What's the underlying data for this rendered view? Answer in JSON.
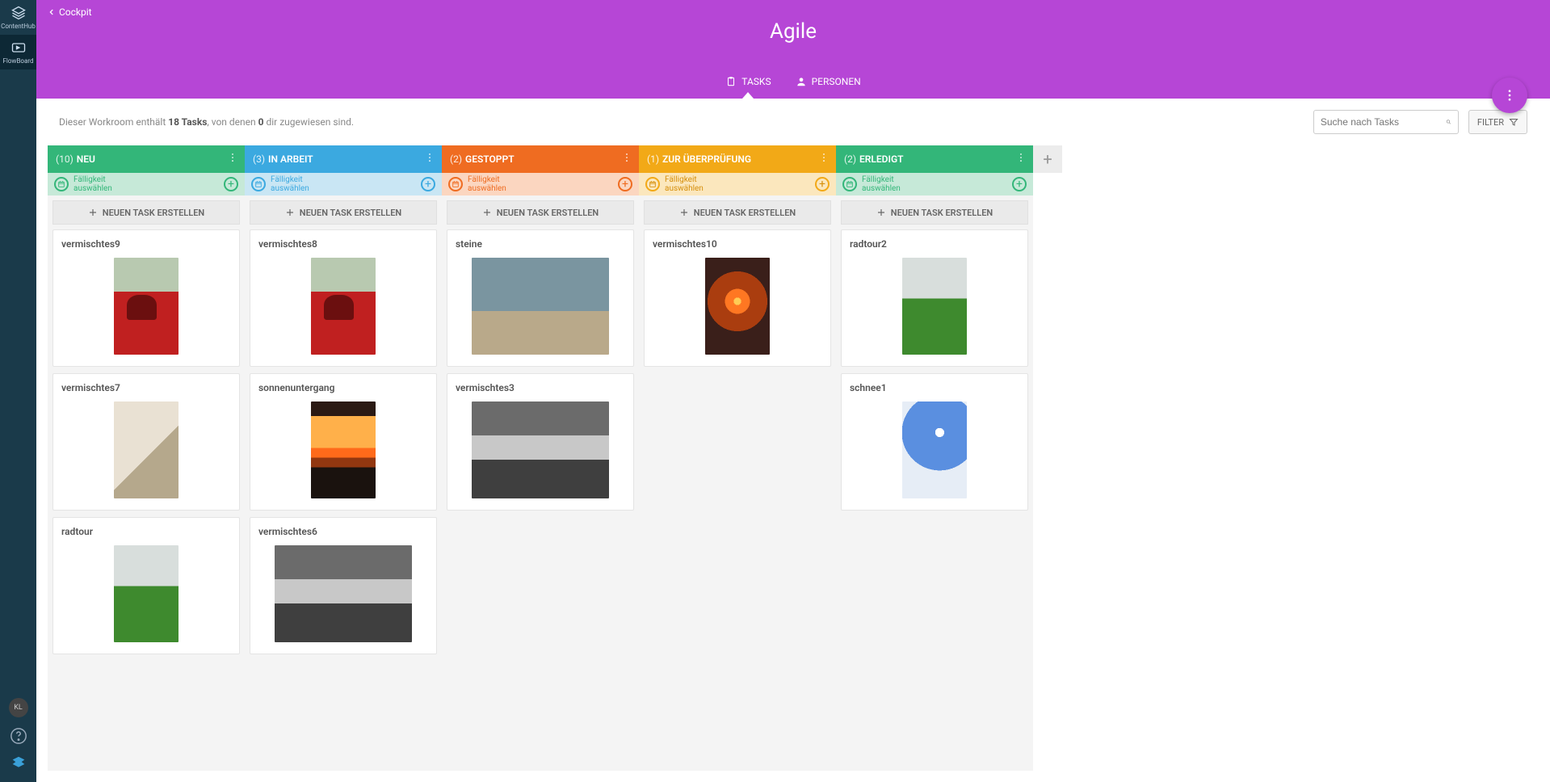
{
  "rail": {
    "items": [
      {
        "label": "ContentHub"
      },
      {
        "label": "FlowBoard"
      }
    ],
    "avatar": "KL"
  },
  "breadcrumb": "Cockpit",
  "title": "Agile",
  "tabs": {
    "tasks": "TASKS",
    "people": "PERSONEN"
  },
  "summary": {
    "pre": "Dieser Workroom enthält ",
    "count": "18 Tasks",
    "mid": ", von denen ",
    "assigned": "0",
    "post": " dir zugewiesen sind."
  },
  "search_placeholder": "Suche nach Tasks",
  "filter_label": "FILTER",
  "due_label": "Fälligkeit\nauswählen",
  "new_task_label": "NEUEN TASK ERSTELLEN",
  "columns": [
    {
      "count": "(10)",
      "name": "NEU",
      "variant": "c-green",
      "cards": [
        {
          "title": "vermischtes9",
          "thumb": "t-redcar",
          "wide": false
        },
        {
          "title": "vermischtes7",
          "thumb": "t-wedding",
          "wide": false
        },
        {
          "title": "radtour",
          "thumb": "t-grass",
          "wide": false
        }
      ]
    },
    {
      "count": "(3)",
      "name": "IN ARBEIT",
      "variant": "c-blue",
      "cards": [
        {
          "title": "vermischtes8",
          "thumb": "t-redcar",
          "wide": false
        },
        {
          "title": "sonnenuntergang",
          "thumb": "t-sunset2",
          "wide": false
        },
        {
          "title": "vermischtes6",
          "thumb": "t-bw",
          "wide": true
        }
      ]
    },
    {
      "count": "(2)",
      "name": "GESTOPPT",
      "variant": "c-orange",
      "cards": [
        {
          "title": "steine",
          "thumb": "t-beach",
          "wide": true
        },
        {
          "title": "vermischtes3",
          "thumb": "t-bw",
          "wide": true
        }
      ]
    },
    {
      "count": "(1)",
      "name": "ZUR ÜBERPRÜFUNG",
      "variant": "c-yellow",
      "cards": [
        {
          "title": "vermischtes10",
          "thumb": "t-sunset1",
          "wide": false
        }
      ]
    },
    {
      "count": "(2)",
      "name": "ERLEDIGT",
      "variant": "c-green",
      "cards": [
        {
          "title": "radtour2",
          "thumb": "t-grass",
          "wide": false
        },
        {
          "title": "schnee1",
          "thumb": "t-snow",
          "wide": false
        }
      ]
    }
  ]
}
